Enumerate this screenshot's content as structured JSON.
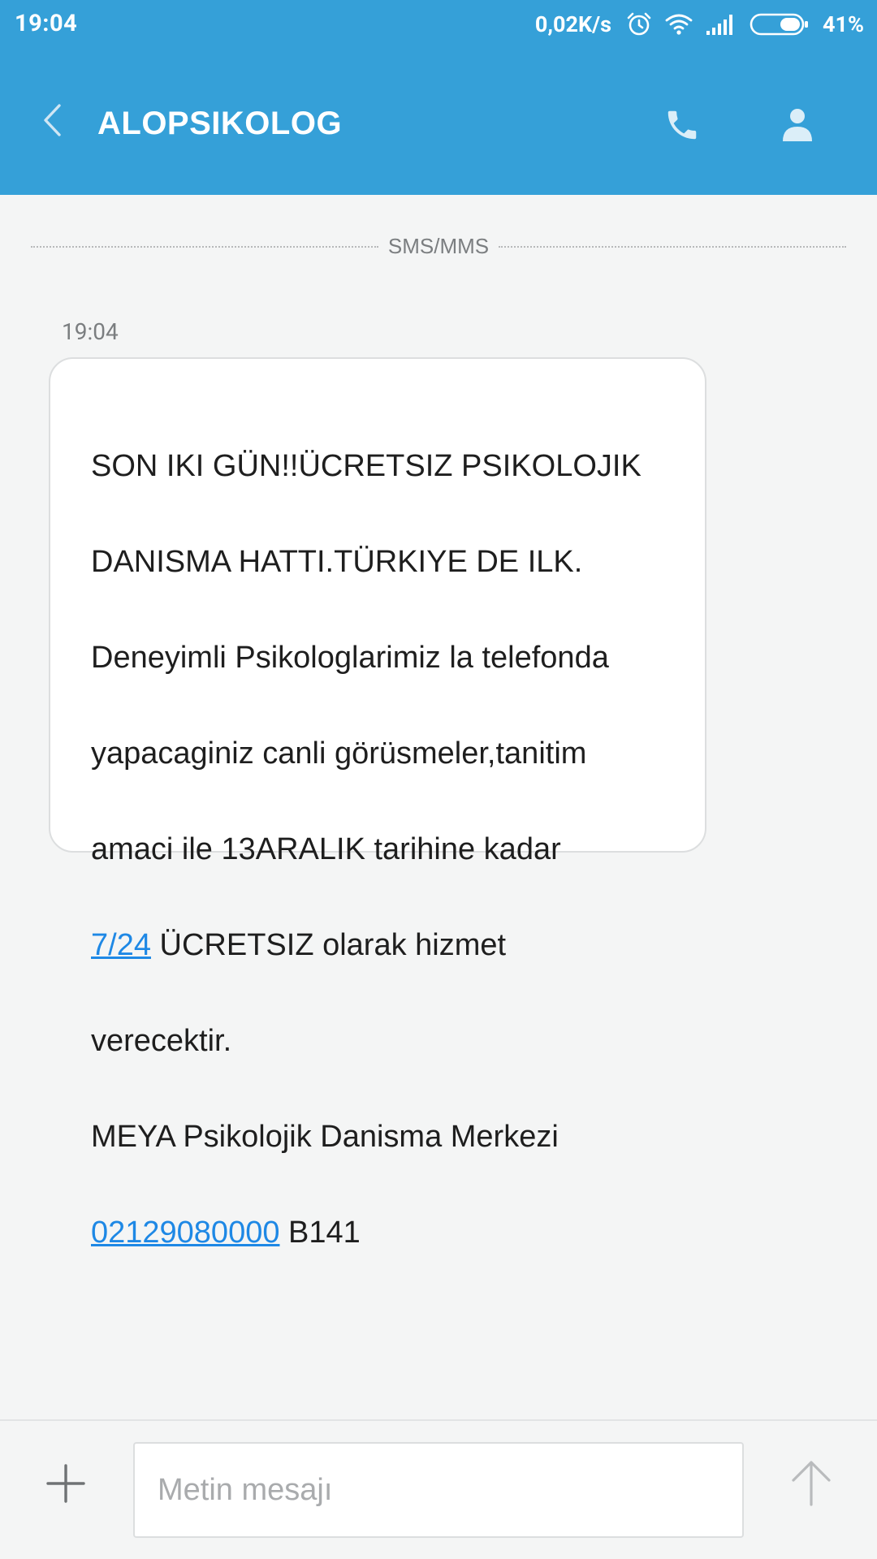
{
  "status_bar": {
    "time": "19:04",
    "net_speed": "0,02K/s",
    "battery": "41%",
    "icons": [
      "alarm-icon",
      "wifi-icon",
      "signal-icon",
      "battery-icon"
    ]
  },
  "app_bar": {
    "title": "ALOPSIKOLOG",
    "back_icon": "chevron-left-icon",
    "call_icon": "phone-icon",
    "contact_icon": "person-icon"
  },
  "divider": {
    "label": "SMS/MMS"
  },
  "message": {
    "time": "19:04",
    "lines": [
      "SON IKI GÜN!!ÜCRETSIZ PSIKOLOJIK",
      "DANISMA HATTI.TÜRKIYE DE ILK.",
      "Deneyimli Psikologlarimiz la telefonda",
      "yapacaginiz canli görüsmeler,tanitim",
      "amaci ile 13ARALIK tarihine kadar"
    ],
    "link_247": "7/24",
    "after_link_247": " ÜCRETSIZ olarak hizmet",
    "line_verecektir": "verecektir.",
    "line_meya": "MEYA Psikolojik Danisma Merkezi",
    "phone_link": "02129080000",
    "after_phone": " B141"
  },
  "composer": {
    "placeholder": "Metin mesajı",
    "attach_icon": "plus-icon",
    "send_icon": "arrow-up-icon"
  },
  "colors": {
    "header_bg": "#35a0d8",
    "page_bg": "#f4f5f5",
    "link": "#1e88e5",
    "bubble_bg": "#ffffff"
  }
}
